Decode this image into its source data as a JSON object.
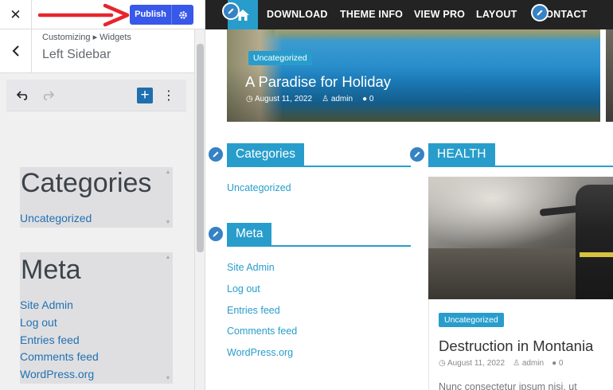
{
  "customizer": {
    "close_label": "✕",
    "publish_label": "Publish",
    "breadcrumb": "Customizing ▸ Widgets",
    "section_title": "Left Sidebar",
    "toolbar": {
      "add_label": "+",
      "more_label": "⋮"
    },
    "panels": [
      {
        "title": "Categories",
        "links": [
          "Uncategorized"
        ]
      },
      {
        "title": "Meta",
        "links": [
          "Site Admin",
          "Log out",
          "Entries feed",
          "Comments feed",
          "WordPress.org"
        ]
      }
    ]
  },
  "preview": {
    "nav": [
      "DOWNLOAD",
      "THEME INFO",
      "VIEW PRO",
      "LAYOUT",
      "CONTACT"
    ],
    "featured": {
      "category": "Uncategorized",
      "title": "A Paradise for Holiday",
      "date": "August 11, 2022",
      "author": "admin",
      "comments": "0"
    },
    "widgets": [
      {
        "title": "Categories",
        "links": [
          "Uncategorized"
        ]
      },
      {
        "title": "Meta",
        "links": [
          "Site Admin",
          "Log out",
          "Entries feed",
          "Comments feed",
          "WordPress.org"
        ]
      }
    ],
    "health": {
      "title": "HEALTH",
      "post": {
        "category": "Uncategorized",
        "title": "Destruction in Montania",
        "date": "August 11, 2022",
        "author": "admin",
        "comments": "0",
        "excerpt": "Nunc consectetur ipsum nisi, ut"
      }
    }
  },
  "colors": {
    "accent": "#289dcc",
    "publish": "#3858e9",
    "annotation_arrow": "#e8252b",
    "nav_bg": "#232323"
  },
  "icons": [
    "close-icon",
    "gear-icon",
    "back-chevron-icon",
    "undo-icon",
    "redo-icon",
    "plus-icon",
    "more-icon",
    "home-icon",
    "pencil-icon",
    "calendar-icon",
    "user-icon",
    "comment-icon"
  ]
}
